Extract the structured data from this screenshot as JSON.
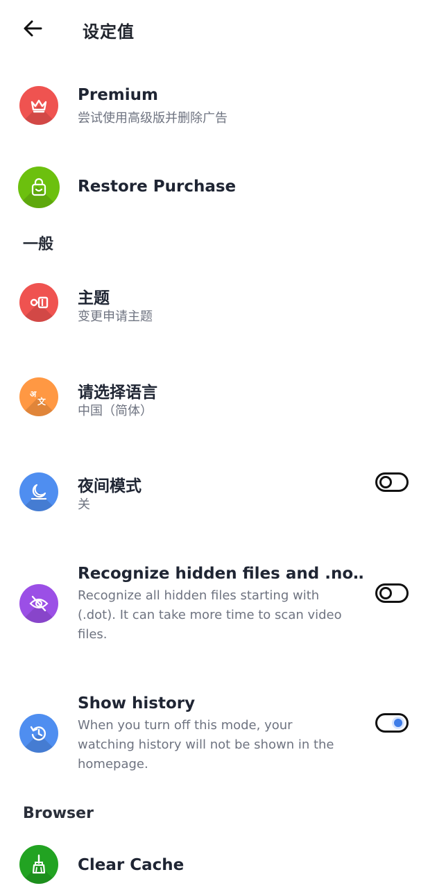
{
  "header": {
    "title": "设定值"
  },
  "items": {
    "premium": {
      "title": "Premium",
      "subtitle": "尝试使用高级版并删除广告",
      "icon": "crown-icon",
      "color": "#ef5350"
    },
    "restore": {
      "title": "Restore Purchase",
      "icon": "shopping-bag-icon",
      "color": "#6cc00e"
    },
    "theme": {
      "title": "主题",
      "subtitle": "变更申请主题",
      "icon": "key-tag-icon",
      "color": "#ef5350"
    },
    "language": {
      "title": "请选择语言",
      "subtitle": "中国（简体）",
      "icon": "translate-icon",
      "color": "#ff9843"
    },
    "night_mode": {
      "title": "夜间模式",
      "subtitle": "关",
      "icon": "moon-icon",
      "color": "#4f8ef0",
      "enabled": false
    },
    "hidden_files": {
      "title": "Recognize hidden files and .no‥",
      "subtitle_line1": "Recognize all hidden files starting with",
      "subtitle_line2": "(.dot). It can take more time to scan video",
      "subtitle_line3": "files.",
      "icon": "eye-off-icon",
      "color": "#9b4fe6",
      "enabled": false
    },
    "history": {
      "title": "Show history",
      "subtitle_line1": "When you turn off this mode, your",
      "subtitle_line2": "watching history will not be shown in the",
      "subtitle_line3": "homepage.",
      "icon": "history-icon",
      "color": "#4f8ef0",
      "enabled": true
    },
    "clear_cache": {
      "title": "Clear Cache",
      "icon": "broom-icon",
      "color": "#22a322"
    }
  },
  "sections": {
    "general": "一般",
    "browser": "Browser"
  }
}
